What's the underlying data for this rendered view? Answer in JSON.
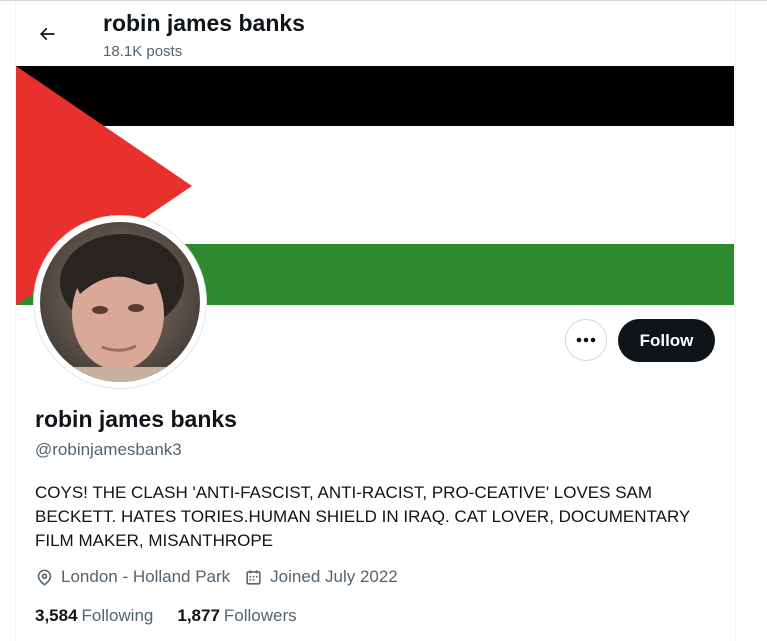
{
  "header": {
    "title": "robin james banks",
    "posts": "18.1K posts"
  },
  "banner": {
    "description": "Palestinian flag",
    "colors": {
      "black": "#000000",
      "white": "#ffffff",
      "green": "#2e8a2e",
      "red": "#e8312d"
    }
  },
  "actions": {
    "follow_label": "Follow",
    "more_icon": "more-horizontal-icon"
  },
  "profile": {
    "display_name": "robin james banks",
    "handle": "@robinjamesbank3",
    "bio": "COYS! THE CLASH 'ANTI-FASCIST, ANTI-RACIST, PRO-CEATIVE' LOVES SAM BECKETT. HATES TORIES.HUMAN SHIELD IN IRAQ. CAT LOVER, DOCUMENTARY FILM MAKER, MISANTHROPE",
    "location": "London - Holland Park",
    "joined": "Joined July 2022"
  },
  "stats": {
    "following_count": "3,584",
    "following_label": "Following",
    "followers_count": "1,877",
    "followers_label": "Followers"
  }
}
